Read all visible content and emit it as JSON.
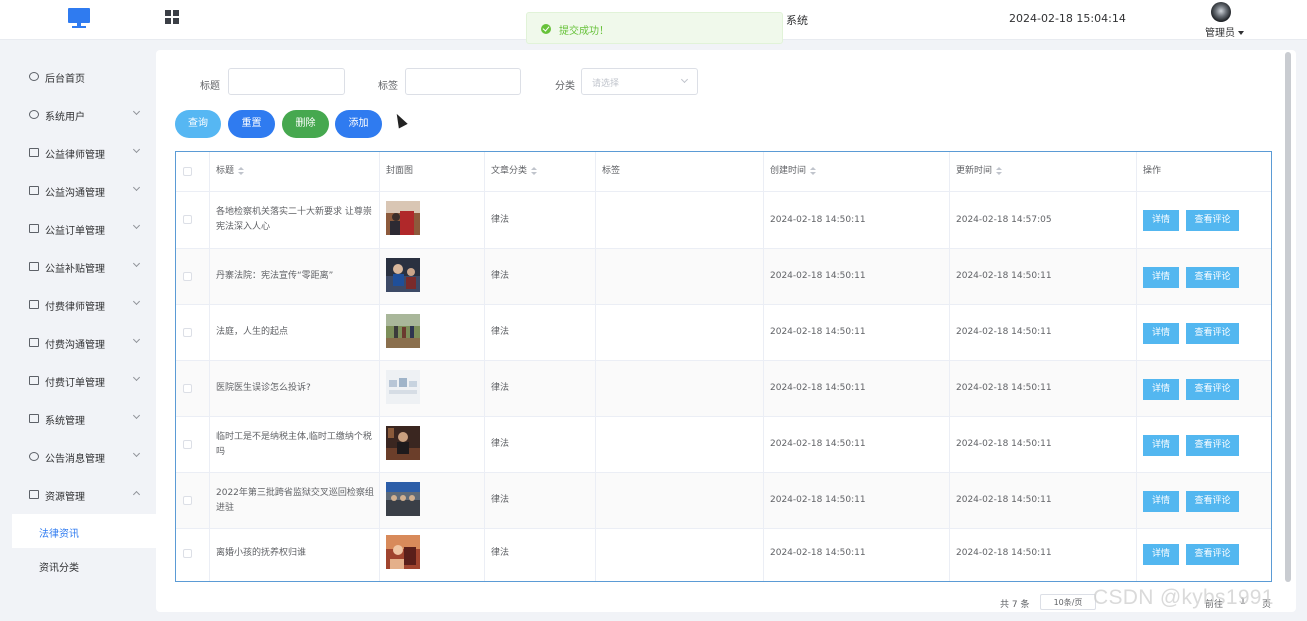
{
  "header": {
    "title_fragment": "系统",
    "datetime": "2024-02-18 15:04:14",
    "user": "管理员"
  },
  "toast": {
    "message": "提交成功！"
  },
  "sidebar": {
    "items": [
      {
        "label": "后台首页",
        "icon": "clock-icon",
        "expandable": false
      },
      {
        "label": "系统用户",
        "icon": "user-icon",
        "expandable": true
      },
      {
        "label": "公益律师管理",
        "icon": "doc-icon",
        "expandable": true
      },
      {
        "label": "公益沟通管理",
        "icon": "doc-icon",
        "expandable": true
      },
      {
        "label": "公益订单管理",
        "icon": "doc-icon",
        "expandable": true
      },
      {
        "label": "公益补贴管理",
        "icon": "doc-icon",
        "expandable": true
      },
      {
        "label": "付费律师管理",
        "icon": "doc-icon",
        "expandable": true
      },
      {
        "label": "付费沟通管理",
        "icon": "doc-icon",
        "expandable": true
      },
      {
        "label": "付费订单管理",
        "icon": "doc-icon",
        "expandable": true
      },
      {
        "label": "系统管理",
        "icon": "folder-icon",
        "expandable": true
      },
      {
        "label": "公告消息管理",
        "icon": "loading-icon",
        "expandable": true
      },
      {
        "label": "资源管理",
        "icon": "storage-icon",
        "expandable": true,
        "expanded": true
      }
    ],
    "subitems": [
      {
        "label": "法律资讯",
        "active": true
      },
      {
        "label": "资讯分类",
        "active": false
      }
    ]
  },
  "filters": {
    "title_label": "标题",
    "title_value": "",
    "tag_label": "标签",
    "tag_value": "",
    "category_label": "分类",
    "category_placeholder": "请选择"
  },
  "buttons": {
    "query": "查询",
    "reset": "重置",
    "delete": "删除",
    "add": "添加"
  },
  "colors": {
    "query": "#56b7f3",
    "reset": "#2f7bf0",
    "delete": "#46a84f",
    "add": "#2f7bf0",
    "action": "#53b7f0",
    "toast_text": "#67c23a"
  },
  "table": {
    "columns": [
      "标题",
      "封面图",
      "文章分类",
      "标签",
      "创建时间",
      "更新时间",
      "操作"
    ],
    "rows": [
      {
        "title": "各地检察机关落实二十大新要求 让尊崇宪法深入人心",
        "category": "律法",
        "tag": "",
        "created": "2024-02-18 14:50:11",
        "updated": "2024-02-18 14:57:05"
      },
      {
        "title": "丹寨法院：宪法宣传“零距离”",
        "category": "律法",
        "tag": "",
        "created": "2024-02-18 14:50:11",
        "updated": "2024-02-18 14:50:11"
      },
      {
        "title": "法庭，人生的起点",
        "category": "律法",
        "tag": "",
        "created": "2024-02-18 14:50:11",
        "updated": "2024-02-18 14:50:11"
      },
      {
        "title": "医院医生误诊怎么投诉?",
        "category": "律法",
        "tag": "",
        "created": "2024-02-18 14:50:11",
        "updated": "2024-02-18 14:50:11"
      },
      {
        "title": "临时工是不是纳税主体,临时工缴纳个税吗",
        "category": "律法",
        "tag": "",
        "created": "2024-02-18 14:50:11",
        "updated": "2024-02-18 14:50:11"
      },
      {
        "title": "2022年第三批跨省监狱交叉巡回检察组进驻",
        "category": "律法",
        "tag": "",
        "created": "2024-02-18 14:50:11",
        "updated": "2024-02-18 14:50:11"
      },
      {
        "title": "离婚小孩的抚养权归谁",
        "category": "律法",
        "tag": "",
        "created": "2024-02-18 14:50:11",
        "updated": "2024-02-18 14:50:11"
      }
    ],
    "detail_label": "详情",
    "comments_label": "查看评论"
  },
  "pagination": {
    "total": "共 7 条",
    "page_size": "10条/页",
    "goto": "前往",
    "page": "1",
    "unit": "页"
  },
  "watermark": "CSDN @kybs1991"
}
